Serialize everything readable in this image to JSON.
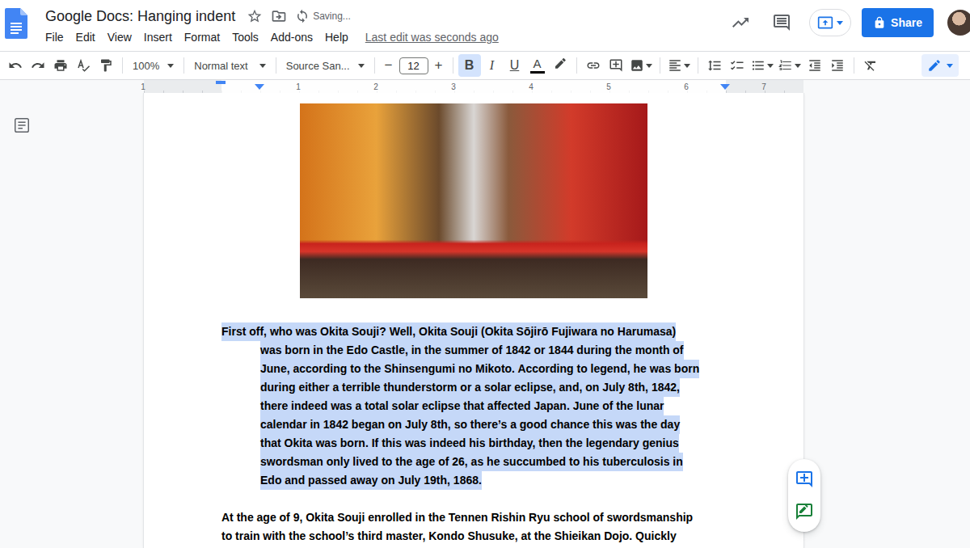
{
  "document": {
    "title": "Google Docs: Hanging indent",
    "starred": false,
    "save_status": "Saving...",
    "last_edit": "Last edit was seconds ago"
  },
  "menu": [
    "File",
    "Edit",
    "View",
    "Insert",
    "Format",
    "Tools",
    "Add-ons",
    "Help"
  ],
  "share": {
    "label": "Share"
  },
  "toolbar": {
    "zoom": "100%",
    "paragraph_style": "Normal text",
    "font": "Source San...",
    "font_size": "12",
    "decrease": "−",
    "increase": "+",
    "text_color": "#000000",
    "format_buttons": [
      {
        "label": "B",
        "kind": "bold",
        "selected": true
      },
      {
        "label": "I",
        "kind": "italic",
        "selected": false
      },
      {
        "label": "U",
        "kind": "underline",
        "selected": false
      },
      {
        "label": "A",
        "kind": "color",
        "selected": false
      }
    ]
  },
  "ruler": {
    "labels": [
      "1",
      "1",
      "2",
      "3",
      "4",
      "5",
      "6",
      "7"
    ]
  },
  "paragraphs": [
    {
      "selected": true,
      "bold": true,
      "hanging_indent": true,
      "lines": [
        "First off, who was Okita Souji? Well, Okita Souji (Okita Sōjirō Fujiwara no Harumasa)",
        "was born in the Edo Castle, in the summer of 1842 or 1844 during the month of",
        "June, according to the Shinsengumi no Mikoto. According to legend, he was born",
        "during either a terrible thunderstorm or a solar eclipse, and, on July 8th, 1842,",
        "there indeed was a total solar eclipse that affected Japan. June of the lunar",
        "calendar in 1842 began on July 8th, so there’s a good chance this was the day",
        "that Okita was born. If this was indeed his birthday, then the legendary genius",
        "swordsman only lived to the age of 26, as he succumbed to his tuberculosis in",
        "Edo and passed away on July 19th, 1868."
      ]
    },
    {
      "selected": false,
      "bold": true,
      "hanging_indent": false,
      "lines": [
        "At the age of 9, Okita Souji enrolled in the Tennen Rishin Ryu school of swordsmanship",
        "to train with the school’s third master, Kondo Shusuke, at the Shieikan Dojo. Quickly"
      ]
    }
  ]
}
